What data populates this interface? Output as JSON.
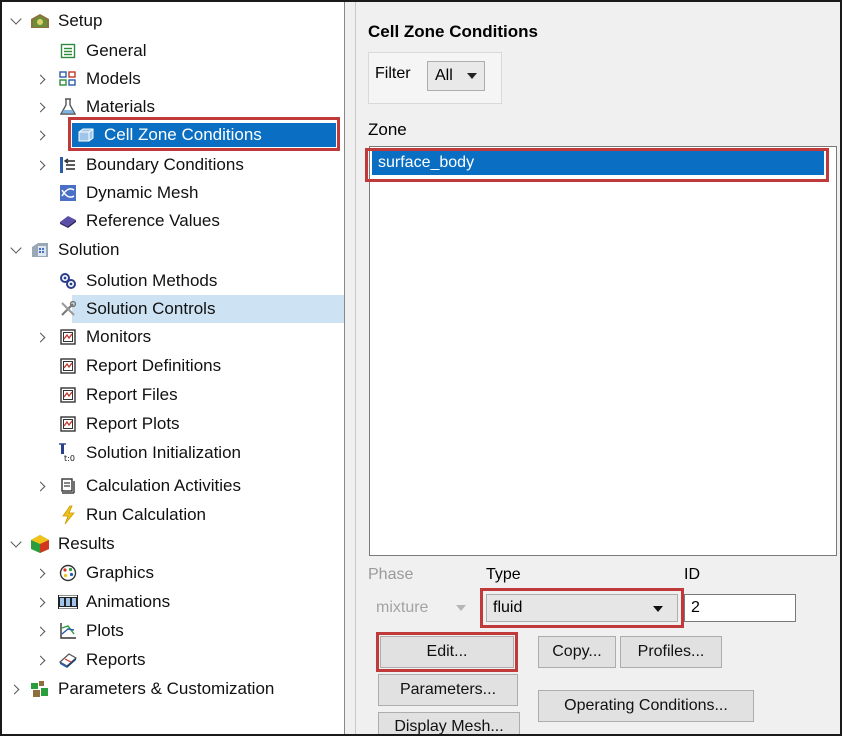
{
  "tree": {
    "items": [
      {
        "label": "Setup",
        "icon": "setup-icon",
        "arrow": "down",
        "level": 0
      },
      {
        "label": "General",
        "icon": "general-icon",
        "arrow": "",
        "level": 1
      },
      {
        "label": "Models",
        "icon": "models-icon",
        "arrow": "right",
        "level": 1
      },
      {
        "label": "Materials",
        "icon": "materials-icon",
        "arrow": "right",
        "level": 1
      },
      {
        "label": "Cell Zone Conditions",
        "icon": "cell-zone-icon",
        "arrow": "right",
        "level": 1,
        "selected_highlight": true
      },
      {
        "label": "Boundary Conditions",
        "icon": "boundary-conditions-icon",
        "arrow": "right",
        "level": 1
      },
      {
        "label": "Dynamic Mesh",
        "icon": "dynamic-mesh-icon",
        "arrow": "",
        "level": 1
      },
      {
        "label": "Reference Values",
        "icon": "reference-values-icon",
        "arrow": "",
        "level": 1
      },
      {
        "label": "Solution",
        "icon": "solution-icon",
        "arrow": "down",
        "level": 0
      },
      {
        "label": "Solution Methods",
        "icon": "solution-methods-icon",
        "arrow": "",
        "level": 1
      },
      {
        "label": "Solution Controls",
        "icon": "solution-controls-icon",
        "arrow": "",
        "level": 1,
        "hover": true
      },
      {
        "label": "Monitors",
        "icon": "monitors-icon",
        "arrow": "right",
        "level": 1
      },
      {
        "label": "Report Definitions",
        "icon": "report-definitions-icon",
        "arrow": "",
        "level": 1
      },
      {
        "label": "Report Files",
        "icon": "report-files-icon",
        "arrow": "",
        "level": 1
      },
      {
        "label": "Report Plots",
        "icon": "report-plots-icon",
        "arrow": "",
        "level": 1
      },
      {
        "label": "Solution Initialization",
        "icon": "solution-initialization-icon",
        "arrow": "",
        "level": 1
      },
      {
        "label": "Calculation Activities",
        "icon": "calculation-activities-icon",
        "arrow": "right",
        "level": 1
      },
      {
        "label": "Run Calculation",
        "icon": "run-calculation-icon",
        "arrow": "",
        "level": 1
      },
      {
        "label": "Results",
        "icon": "results-icon",
        "arrow": "down",
        "level": 0
      },
      {
        "label": "Graphics",
        "icon": "graphics-icon",
        "arrow": "right",
        "level": 1
      },
      {
        "label": "Animations",
        "icon": "animations-icon",
        "arrow": "right",
        "level": 1
      },
      {
        "label": "Plots",
        "icon": "plots-icon",
        "arrow": "right",
        "level": 1
      },
      {
        "label": "Reports",
        "icon": "reports-icon",
        "arrow": "right",
        "level": 1
      },
      {
        "label": "Parameters & Customization",
        "icon": "parameters-customization-icon",
        "arrow": "right",
        "level": 0
      }
    ]
  },
  "panel": {
    "title": "Cell Zone Conditions",
    "filter_label": "Filter",
    "filter_value": "All",
    "zone_label": "Zone",
    "zones": [
      "surface_body"
    ],
    "phase_label": "Phase",
    "phase_value": "mixture",
    "type_label": "Type",
    "type_value": "fluid",
    "id_label": "ID",
    "id_value": "2",
    "buttons": {
      "edit": "Edit...",
      "copy": "Copy...",
      "profiles": "Profiles...",
      "parameters": "Parameters...",
      "operating_conditions": "Operating Conditions...",
      "display_mesh": "Display Mesh..."
    }
  },
  "colors": {
    "selection": "#0a6fc2",
    "hover": "#cde3f3",
    "annotation": "#c0393b",
    "panel_bg": "#f0f0f0"
  }
}
